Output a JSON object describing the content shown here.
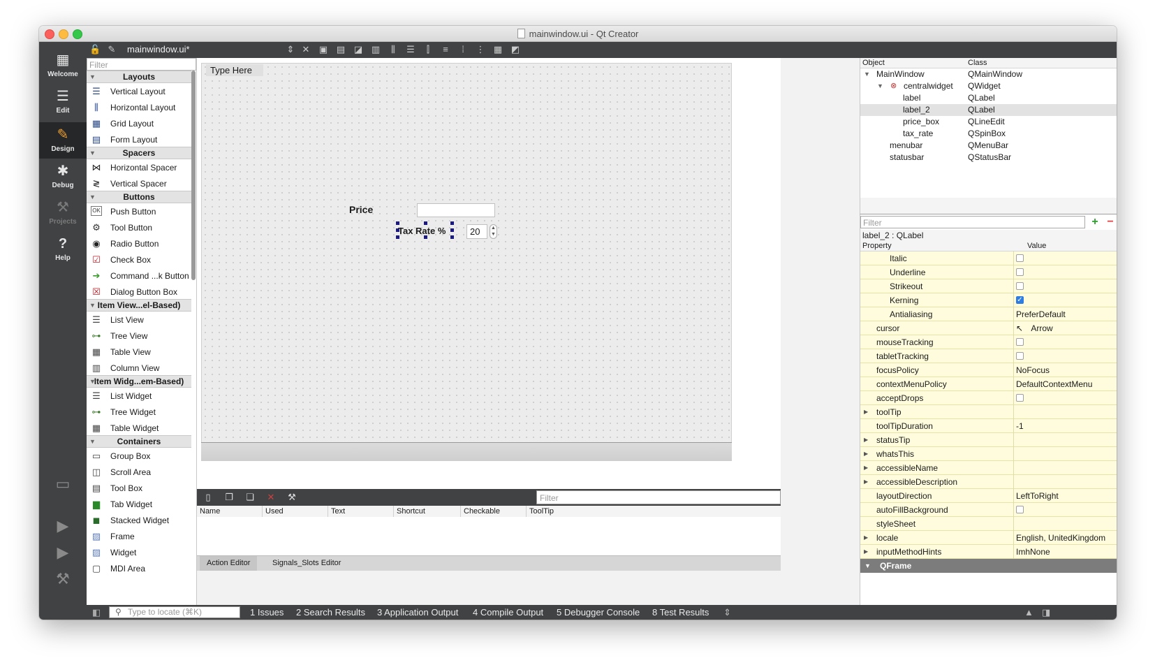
{
  "window": {
    "title": "mainwindow.ui - Qt Creator"
  },
  "modes": [
    {
      "label": "Welcome",
      "icon": "grid-icon"
    },
    {
      "label": "Edit",
      "icon": "document-icon"
    },
    {
      "label": "Design",
      "icon": "pencil-icon"
    },
    {
      "label": "Debug",
      "icon": "bug-icon"
    },
    {
      "label": "Projects",
      "icon": "wrench-icon"
    },
    {
      "label": "Help",
      "icon": "help-icon"
    }
  ],
  "toolbar": {
    "file": "mainwindow.ui*"
  },
  "widgetbox": {
    "filter_placeholder": "Filter",
    "categories": [
      "Layouts",
      "Spacers",
      "Buttons",
      "Item View...el-Based)",
      "Item Widg...em-Based)",
      "Containers"
    ],
    "items": {
      "layouts": [
        "Vertical Layout",
        "Horizontal Layout",
        "Grid Layout",
        "Form Layout"
      ],
      "spacers": [
        "Horizontal Spacer",
        "Vertical Spacer"
      ],
      "buttons": [
        "Push Button",
        "Tool Button",
        "Radio Button",
        "Check Box",
        "Command ...k Button",
        "Dialog Button Box"
      ],
      "itemviews": [
        "List View",
        "Tree View",
        "Table View",
        "Column View"
      ],
      "itemwidgets": [
        "List Widget",
        "Tree Widget",
        "Table Widget"
      ],
      "containers": [
        "Group Box",
        "Scroll Area",
        "Tool Box",
        "Tab Widget",
        "Stacked Widget",
        "Frame",
        "Widget",
        "MDI Area"
      ]
    }
  },
  "form": {
    "menu_placeholder": "Type Here",
    "price_label": "Price",
    "tax_label": "Tax Rate %",
    "tax_value": "20"
  },
  "action_editor": {
    "filter_placeholder": "Filter",
    "columns": [
      "Name",
      "Used",
      "Text",
      "Shortcut",
      "Checkable",
      "ToolTip"
    ],
    "tabs": [
      "Action Editor",
      "Signals_Slots Editor"
    ]
  },
  "object_inspector": {
    "headers": [
      "Object",
      "Class"
    ],
    "rows": [
      {
        "name": "MainWindow",
        "cls": "QMainWindow"
      },
      {
        "name": "centralwidget",
        "cls": "QWidget"
      },
      {
        "name": "label",
        "cls": "QLabel"
      },
      {
        "name": "label_2",
        "cls": "QLabel"
      },
      {
        "name": "price_box",
        "cls": "QLineEdit"
      },
      {
        "name": "tax_rate",
        "cls": "QSpinBox"
      },
      {
        "name": "menubar",
        "cls": "QMenuBar"
      },
      {
        "name": "statusbar",
        "cls": "QStatusBar"
      }
    ]
  },
  "property_editor": {
    "filter_placeholder": "Filter",
    "object": "label_2 : QLabel",
    "headers": [
      "Property",
      "Value"
    ],
    "rows": [
      {
        "name": "Italic",
        "value": "",
        "checked": false
      },
      {
        "name": "Underline",
        "value": "",
        "checked": false
      },
      {
        "name": "Strikeout",
        "value": "",
        "checked": false
      },
      {
        "name": "Kerning",
        "value": "",
        "checked": true
      },
      {
        "name": "Antialiasing",
        "value": "PreferDefault"
      },
      {
        "name": "cursor",
        "value": "Arrow"
      },
      {
        "name": "mouseTracking",
        "value": "",
        "checked": false
      },
      {
        "name": "tabletTracking",
        "value": "",
        "checked": false
      },
      {
        "name": "focusPolicy",
        "value": "NoFocus"
      },
      {
        "name": "contextMenuPolicy",
        "value": "DefaultContextMenu"
      },
      {
        "name": "acceptDrops",
        "value": "",
        "checked": false
      },
      {
        "name": "toolTip",
        "value": ""
      },
      {
        "name": "toolTipDuration",
        "value": "-1"
      },
      {
        "name": "statusTip",
        "value": ""
      },
      {
        "name": "whatsThis",
        "value": ""
      },
      {
        "name": "accessibleName",
        "value": ""
      },
      {
        "name": "accessibleDescription",
        "value": ""
      },
      {
        "name": "layoutDirection",
        "value": "LeftToRight"
      },
      {
        "name": "autoFillBackground",
        "value": "",
        "checked": false
      },
      {
        "name": "styleSheet",
        "value": ""
      },
      {
        "name": "locale",
        "value": "English, UnitedKingdom"
      },
      {
        "name": "inputMethodHints",
        "value": "ImhNone"
      }
    ],
    "section": "QFrame"
  },
  "statusbar": {
    "locate_placeholder": "Type to locate (⌘K)",
    "panes": [
      "1  Issues",
      "2  Search Results",
      "3  Application Output",
      "4  Compile Output",
      "5  Debugger Console",
      "8  Test Results"
    ]
  },
  "colors": {
    "property_row": "#fefcdc",
    "sidebar": "#404244",
    "selection_handle": "#1a1a80"
  }
}
